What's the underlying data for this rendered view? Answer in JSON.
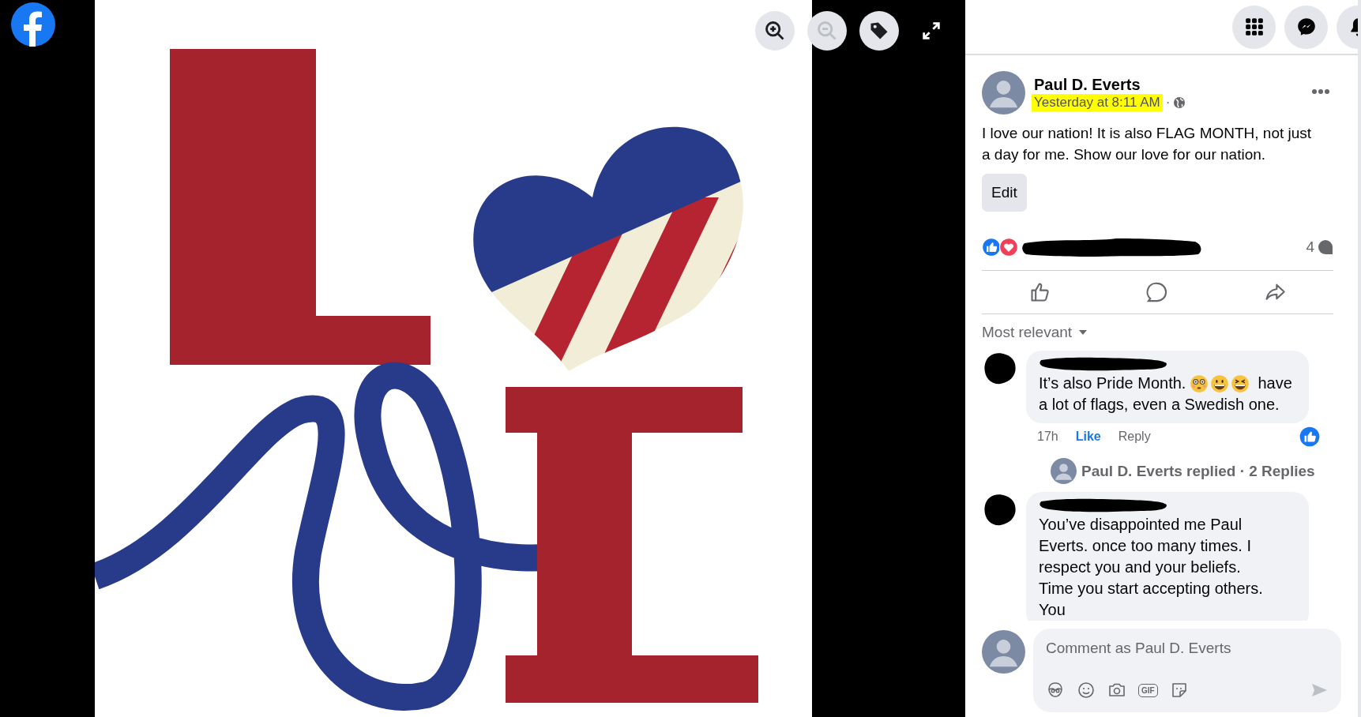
{
  "viewer": {
    "controls": [
      {
        "kind": "zoom-in",
        "disabled": false
      },
      {
        "kind": "zoom-out",
        "disabled": true
      },
      {
        "kind": "tag",
        "disabled": false
      },
      {
        "kind": "fullscreen",
        "disabled": false
      }
    ]
  },
  "top_bar": {
    "buttons": [
      {
        "kind": "menu"
      },
      {
        "kind": "messenger"
      },
      {
        "kind": "notifications"
      }
    ]
  },
  "post": {
    "author": "Paul D. Everts",
    "time": "Yesterday at 8:11 AM",
    "time_highlighted": true,
    "separator": "·",
    "text": "I love our nation! It is also FLAG MONTH, not just a day for me. Show our love for our nation.",
    "edit_button": "Edit",
    "comment_count": "4"
  },
  "comments": {
    "sort": "Most relevant",
    "items": [
      {
        "segments": [
          {
            "kind": "text",
            "text": "It’s also Pride Month."
          },
          {
            "kind": "flushed"
          },
          {
            "kind": "grinning"
          },
          {
            "kind": "laughing"
          },
          {
            "kind": "text",
            "text": "have"
          },
          {
            "kind": "text",
            "text": "a lot of flags, even a Swedish one."
          }
        ],
        "meta": {
          "time": "17h",
          "like": "Like",
          "liked": true,
          "reply": "Reply"
        },
        "replies": "Paul D. Everts replied · 2 Replies"
      },
      {
        "segments": [
          {
            "kind": "text",
            "text": "You’ve disappointed me Paul Everts. once too many times. I respect you and your beliefs. Time you start accepting others. You"
          }
        ]
      }
    ]
  },
  "composer": {
    "placeholder": "Comment as Paul D. Everts",
    "tools": [
      {
        "kind": "avatar"
      },
      {
        "kind": "emoji"
      },
      {
        "kind": "camera"
      },
      {
        "kind": "gif",
        "label": "GIF"
      },
      {
        "kind": "sticker"
      }
    ]
  }
}
